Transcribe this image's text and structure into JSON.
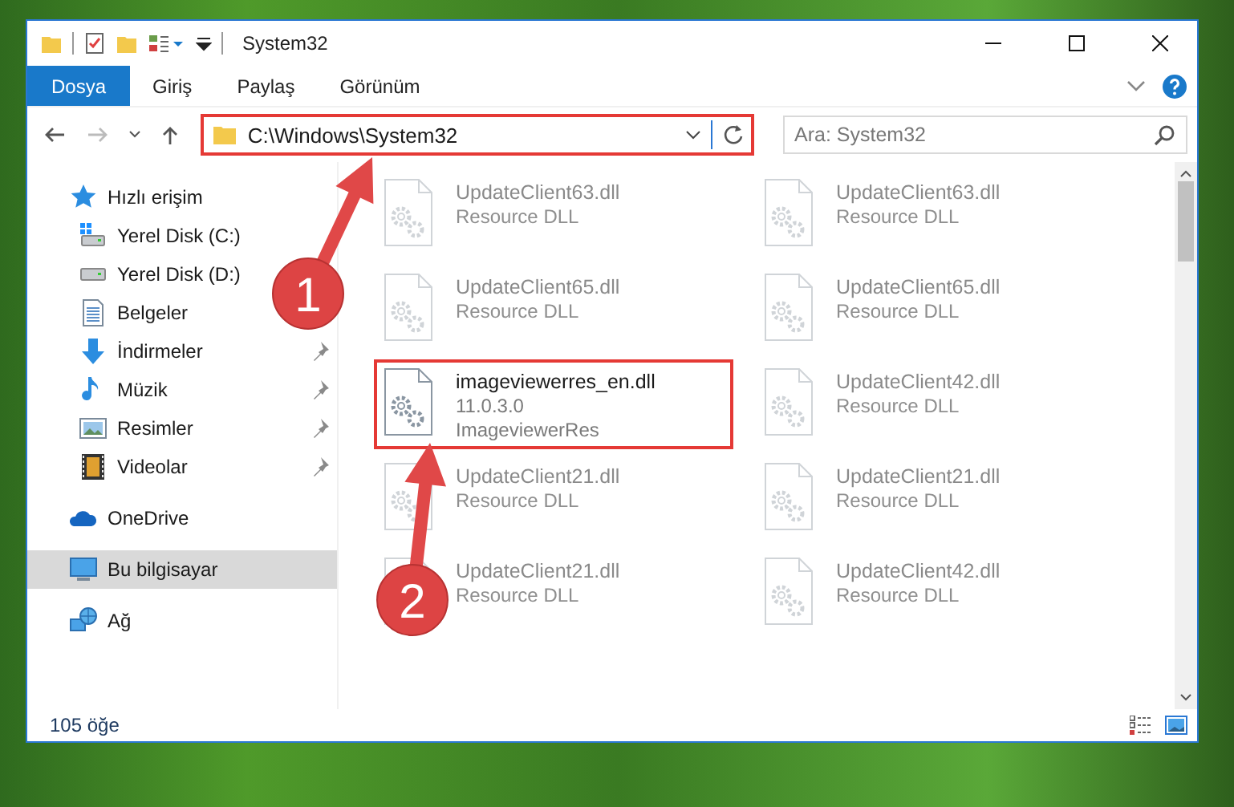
{
  "window": {
    "title": "System32"
  },
  "ribbon": {
    "tabs": [
      {
        "label": "Dosya",
        "kind": "file-menu"
      },
      {
        "label": "Giriş",
        "kind": "tab"
      },
      {
        "label": "Paylaş",
        "kind": "tab"
      },
      {
        "label": "Görünüm",
        "kind": "tab"
      }
    ]
  },
  "address_bar": {
    "path": "C:\\Windows\\System32",
    "highlighted": true
  },
  "search": {
    "placeholder": "Ara: System32"
  },
  "navigation": {
    "items": [
      {
        "label": "Hızlı erişim",
        "kind": "star",
        "selected": false,
        "children": [
          {
            "label": "Yerel Disk (C:)",
            "kind": "drive-win",
            "pinned": false,
            "selected": false
          },
          {
            "label": "Yerel Disk (D:)",
            "kind": "drive",
            "pinned": false,
            "selected": false
          },
          {
            "label": "Belgeler",
            "kind": "documents",
            "pinned": false,
            "selected": false
          },
          {
            "label": "İndirmeler",
            "kind": "download",
            "pinned": true,
            "selected": false
          },
          {
            "label": "Müzik",
            "kind": "music",
            "pinned": true,
            "selected": false
          },
          {
            "label": "Resimler",
            "kind": "pictures",
            "pinned": true,
            "selected": false
          },
          {
            "label": "Videolar",
            "kind": "video",
            "pinned": true,
            "selected": false
          }
        ]
      },
      {
        "label": "OneDrive",
        "kind": "cloud",
        "selected": false
      },
      {
        "label": "Bu bilgisayar",
        "kind": "pc",
        "selected": true
      },
      {
        "label": "Ağ",
        "kind": "network",
        "selected": false
      }
    ]
  },
  "files": [
    {
      "name": "UpdateClient63.dll",
      "details": [
        "Resource DLL"
      ],
      "blurred": true,
      "highlighted": false
    },
    {
      "name": "UpdateClient63.dll",
      "details": [
        "Resource DLL"
      ],
      "blurred": true,
      "highlighted": false
    },
    {
      "name": "UpdateClient65.dll",
      "details": [
        "Resource DLL"
      ],
      "blurred": true,
      "highlighted": false
    },
    {
      "name": "UpdateClient65.dll",
      "details": [
        "Resource DLL"
      ],
      "blurred": true,
      "highlighted": false
    },
    {
      "name": "imageviewerres_en.dll",
      "details": [
        "11.0.3.0",
        "ImageviewerRes"
      ],
      "blurred": false,
      "highlighted": true
    },
    {
      "name": "UpdateClient42.dll",
      "details": [
        "Resource DLL"
      ],
      "blurred": true,
      "highlighted": false
    },
    {
      "name": "UpdateClient21.dll",
      "details": [
        "Resource DLL"
      ],
      "blurred": true,
      "highlighted": false
    },
    {
      "name": "UpdateClient21.dll",
      "details": [
        "Resource DLL"
      ],
      "blurred": true,
      "highlighted": false
    },
    {
      "name": "UpdateClient21.dll",
      "details": [
        "Resource DLL"
      ],
      "blurred": true,
      "highlighted": false
    },
    {
      "name": "UpdateClient42.dll",
      "details": [
        "Resource DLL"
      ],
      "blurred": true,
      "highlighted": false
    }
  ],
  "callouts": [
    {
      "number": "1"
    },
    {
      "number": "2"
    }
  ],
  "status_bar": {
    "item_count": "105 öğe"
  }
}
